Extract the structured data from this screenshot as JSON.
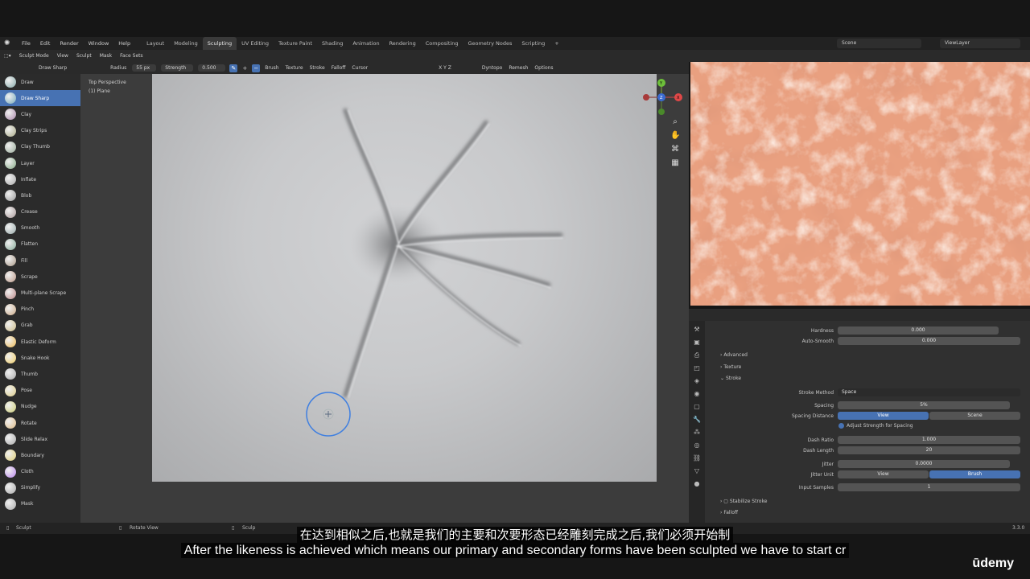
{
  "menu": [
    "File",
    "Edit",
    "Render",
    "Window",
    "Help"
  ],
  "workspaces": [
    "Layout",
    "Modeling",
    "Sculpting",
    "UV Editing",
    "Texture Paint",
    "Shading",
    "Animation",
    "Rendering",
    "Compositing",
    "Geometry Nodes",
    "Scripting"
  ],
  "active_workspace": "Sculpting",
  "scene": "Scene",
  "view_layer": "ViewLayer",
  "header2": {
    "mode": "Sculpt Mode",
    "items": [
      "View",
      "Sculpt",
      "Mask",
      "Face Sets"
    ]
  },
  "header3": {
    "brush_name": "Draw Sharp",
    "radius_label": "Radius",
    "radius_value": "55 px",
    "strength_label": "Strength",
    "strength_value": "0.500",
    "menus": [
      "Brush",
      "Texture",
      "Stroke",
      "Falloff",
      "Cursor"
    ],
    "axes": "X  Y  Z",
    "dyntopo": "Dyntopo",
    "remesh": "Remesh",
    "options": "Options"
  },
  "tools": [
    "Draw",
    "Draw Sharp",
    "Clay",
    "Clay Strips",
    "Clay Thumb",
    "Layer",
    "Inflate",
    "Blob",
    "Crease",
    "Smooth",
    "Flatten",
    "Fill",
    "Scrape",
    "Multi-plane Scrape",
    "Pinch",
    "Grab",
    "Elastic Deform",
    "Snake Hook",
    "Thumb",
    "Pose",
    "Nudge",
    "Rotate",
    "Slide Relax",
    "Boundary",
    "Cloth",
    "Simplify",
    "Mask"
  ],
  "active_tool": "Draw Sharp",
  "viewport": {
    "view_name": "Top Perspective",
    "object": "(1) Plane"
  },
  "properties": {
    "hardness_label": "Hardness",
    "hardness_value": "0.000",
    "autosmooth_label": "Auto-Smooth",
    "autosmooth_value": "0.000",
    "advanced": "Advanced",
    "texture": "Texture",
    "stroke": "Stroke",
    "stroke_method_label": "Stroke Method",
    "stroke_method_value": "Space",
    "spacing_label": "Spacing",
    "spacing_value": "5%",
    "spacing_distance_label": "Spacing Distance",
    "spacing_distance_opts": [
      "View",
      "Scene"
    ],
    "adjust_strength": "Adjust Strength for Spacing",
    "dash_ratio_label": "Dash Ratio",
    "dash_ratio_value": "1.000",
    "dash_length_label": "Dash Length",
    "dash_length_value": "20",
    "jitter_label": "Jitter",
    "jitter_value": "0.0000",
    "jitter_unit_label": "Jitter Unit",
    "jitter_unit_opts": [
      "View",
      "Brush"
    ],
    "input_samples_label": "Input Samples",
    "input_samples_value": "1",
    "stabilize": "Stabilize Stroke",
    "falloff": "Falloff"
  },
  "statusbar": {
    "left": "Sculpt",
    "mid": "Rotate View",
    "mid2": "Sculp",
    "version": "3.3.0"
  },
  "subtitle_cn": "在达到相似之后,也就是我们的主要和次要形态已经雕刻完成之后,我们必须开始制",
  "subtitle_en": "After the likeness is achieved which means our primary and secondary forms have been sculpted we have to start cr",
  "watermark": "ūdemy",
  "colors": {
    "accent": "#4772b3",
    "skin": "#e9a583"
  },
  "icons": [
    "blender-logo-icon",
    "zoom-icon",
    "hand-pan-icon",
    "camera-icon",
    "grid-icon",
    "brush-cursor-icon"
  ]
}
